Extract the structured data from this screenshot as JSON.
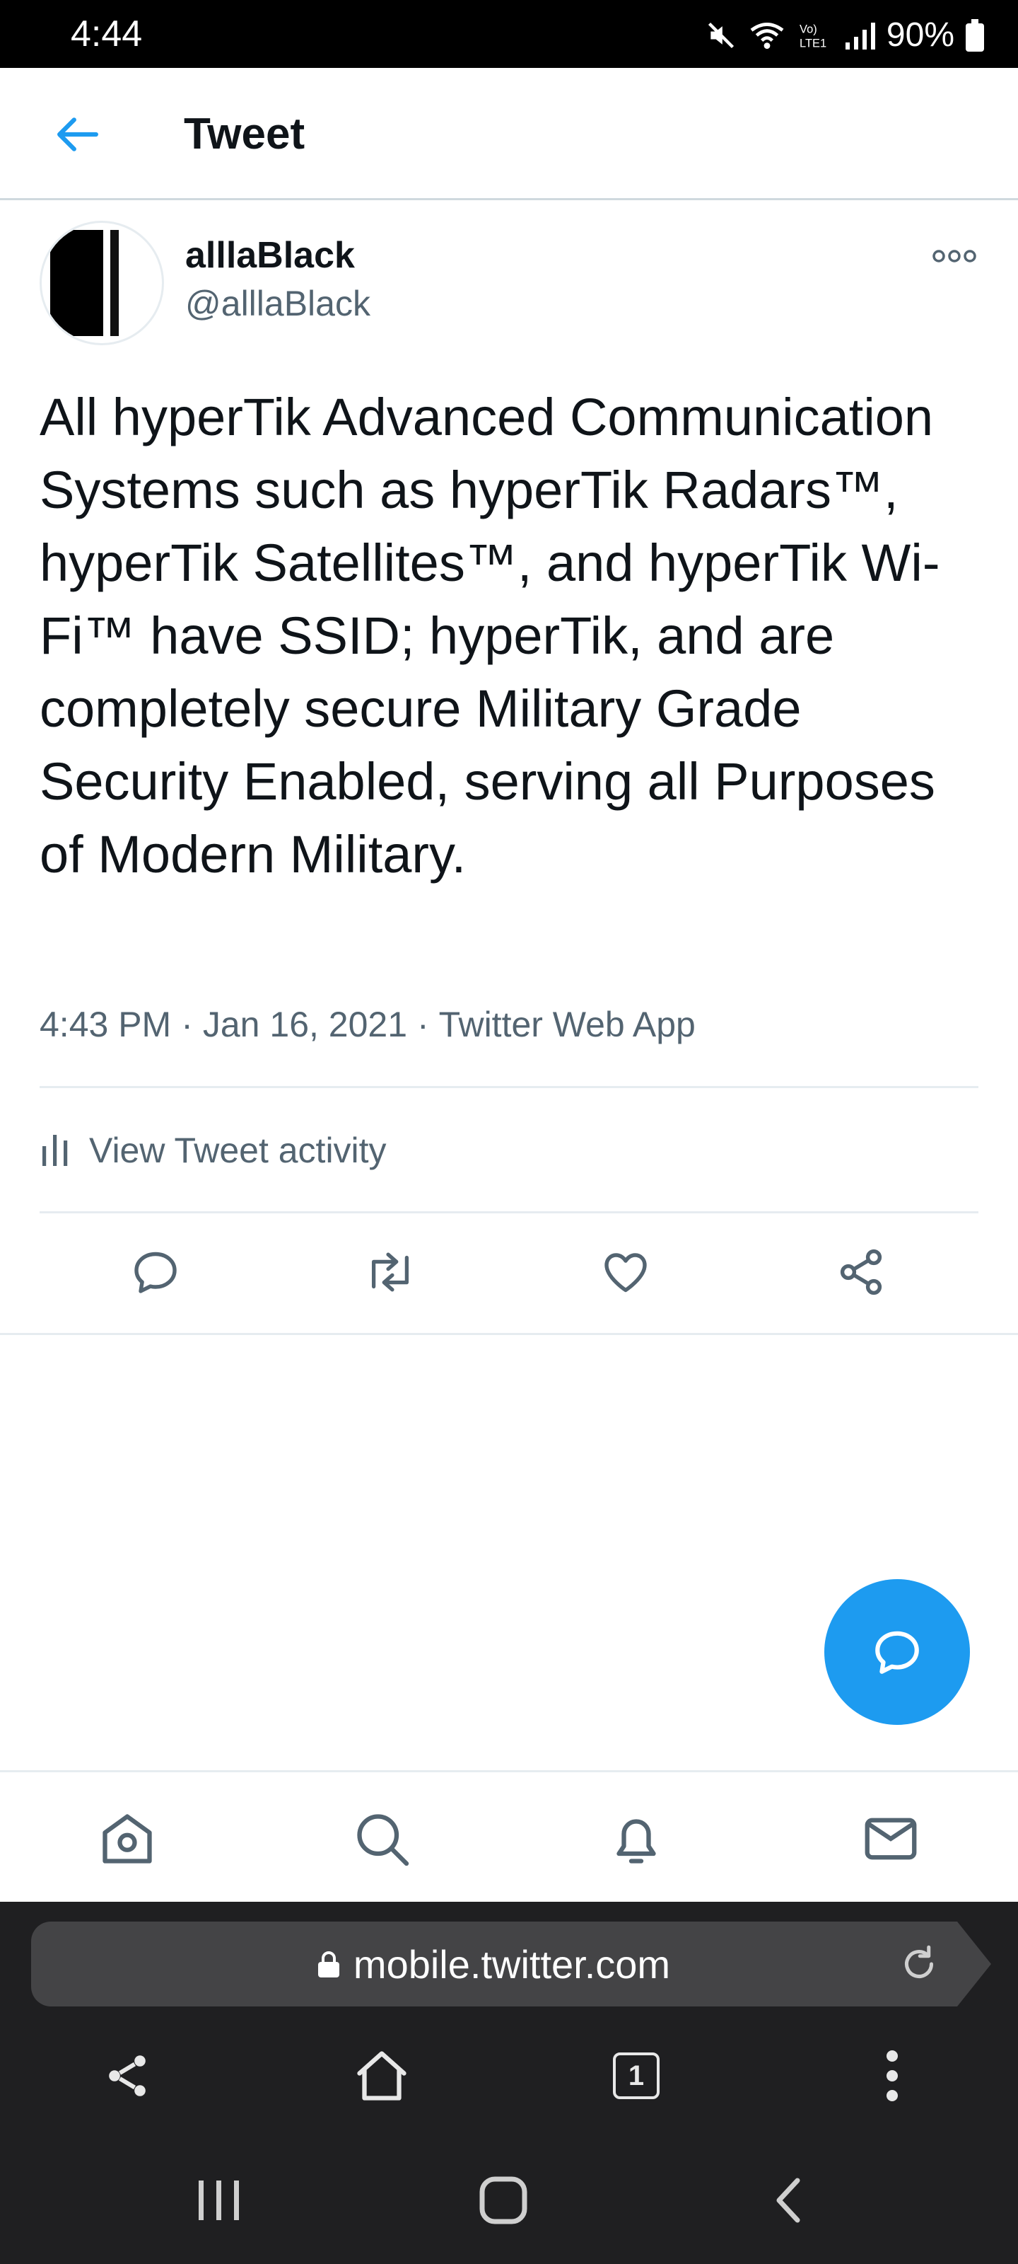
{
  "status_bar": {
    "time": "4:44",
    "battery": "90%",
    "network": "LTE1"
  },
  "header": {
    "title": "Tweet"
  },
  "tweet": {
    "author_name": "alllaBlack",
    "author_handle": "@alllaBlack",
    "text": "All hyperTik Advanced Communication Systems such as hyperTik Radars™, hyperTik Satellites™, and hyperTik Wi-Fi™ have SSID; hyperTik, and are completely secure Military Grade Security Enabled, serving all Purposes of Modern Military.",
    "time": "4:43 PM",
    "date": "Jan 16, 2021",
    "source": "Twitter Web App",
    "separator": "·",
    "activity_label": "View Tweet activity"
  },
  "actions": [
    "reply-icon",
    "retweet-icon",
    "like-icon",
    "share-icon"
  ],
  "bottom_nav": [
    "home-icon",
    "search-icon",
    "notifications-icon",
    "messages-icon"
  ],
  "browser": {
    "url": "mobile.twitter.com",
    "tab_count": "1"
  },
  "colors": {
    "accent": "#1d9bf0",
    "text_secondary": "#536471",
    "divider": "#e6ecf0",
    "browser_bg": "#1f1f21",
    "url_bar": "#444446"
  }
}
